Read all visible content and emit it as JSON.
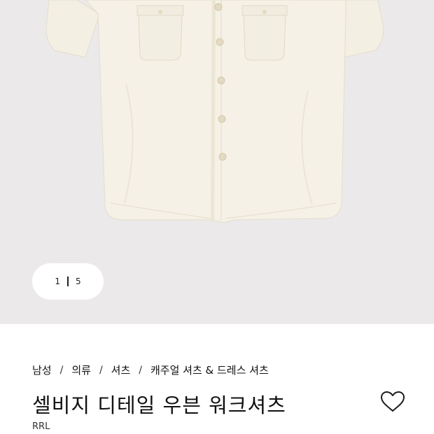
{
  "gallery": {
    "current_index": "1",
    "total": "5",
    "image_alt": "shirt-product-image"
  },
  "breadcrumb": {
    "items": [
      "남성",
      "의류",
      "셔츠",
      "캐주얼 셔츠 & 드레스 셔츠"
    ],
    "separator": "/"
  },
  "product": {
    "title": "셀비지 디테일 우븐 워크셔츠",
    "brand": "RRL"
  },
  "icons": {
    "wishlist": "heart-outline-icon"
  },
  "colors": {
    "gallery_background": "#ece9ea",
    "shirt": "#f5f1e6",
    "text": "#111111"
  }
}
